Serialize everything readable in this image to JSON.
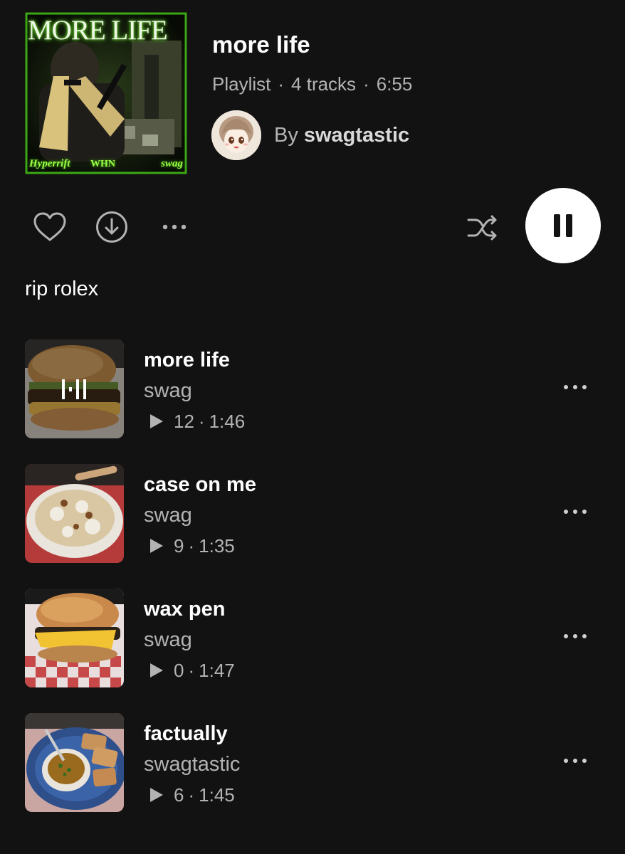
{
  "playlist": {
    "cover_title": "MORE LIFE",
    "cover_tags": [
      "Hyperrift",
      "WHN",
      "swag"
    ],
    "title": "more life",
    "type_label": "Playlist",
    "track_count": "4 tracks",
    "duration": "6:55",
    "by_label": "By",
    "owner": "swagtastic",
    "description": "rip rolex"
  },
  "actions": {
    "like": "heart-icon",
    "download": "download-icon",
    "more": "more-options-icon",
    "shuffle": "shuffle-icon",
    "play_state": "pause-icon"
  },
  "tracks": [
    {
      "title": "more life",
      "artist": "swag",
      "plays": "12",
      "duration": "1:46",
      "now_playing": true
    },
    {
      "title": "case on me",
      "artist": "swag",
      "plays": "9",
      "duration": "1:35",
      "now_playing": false
    },
    {
      "title": "wax pen",
      "artist": "swag",
      "plays": "0",
      "duration": "1:47",
      "now_playing": false
    },
    {
      "title": "factually",
      "artist": "swagtastic",
      "plays": "6",
      "duration": "1:45",
      "now_playing": false
    }
  ],
  "colors": {
    "background": "#121212",
    "primary_text": "#ffffff",
    "secondary_text": "#b3b3b3",
    "play_button": "#ffffff"
  }
}
